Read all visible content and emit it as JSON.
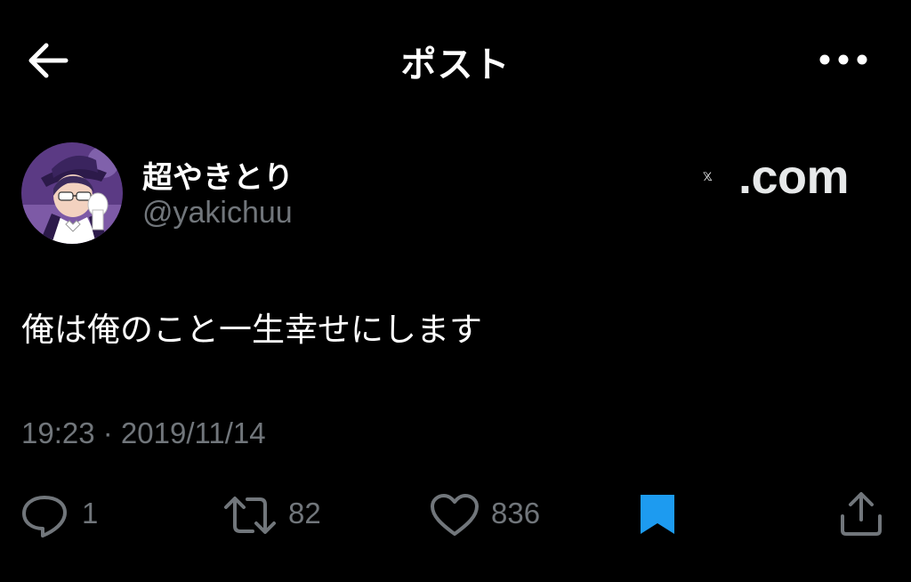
{
  "header": {
    "title": "ポスト",
    "back_icon": "arrow-left-icon",
    "more_icon": "more-horizontal-icon"
  },
  "author": {
    "display_name": "超やきとり",
    "handle": "@yakichuu",
    "avatar_icon": "avatar-illustration"
  },
  "watermark": {
    "logo": "x-logo",
    "text": ".com"
  },
  "post": {
    "text": "俺は俺のこと一生幸せにします",
    "timestamp": "19:23 · 2019/11/14"
  },
  "actions": {
    "reply": {
      "icon": "reply-bubble-icon",
      "count": "1"
    },
    "repost": {
      "icon": "repost-arrows-icon",
      "count": "82"
    },
    "like": {
      "icon": "heart-icon",
      "count": "836"
    },
    "bookmark": {
      "icon": "bookmark-icon",
      "active": true,
      "color": "#1d9bf0"
    },
    "share": {
      "icon": "share-upload-icon"
    }
  },
  "colors": {
    "background": "#000000",
    "text_primary": "#ffffff",
    "text_secondary": "#71767b",
    "accent": "#1d9bf0"
  }
}
